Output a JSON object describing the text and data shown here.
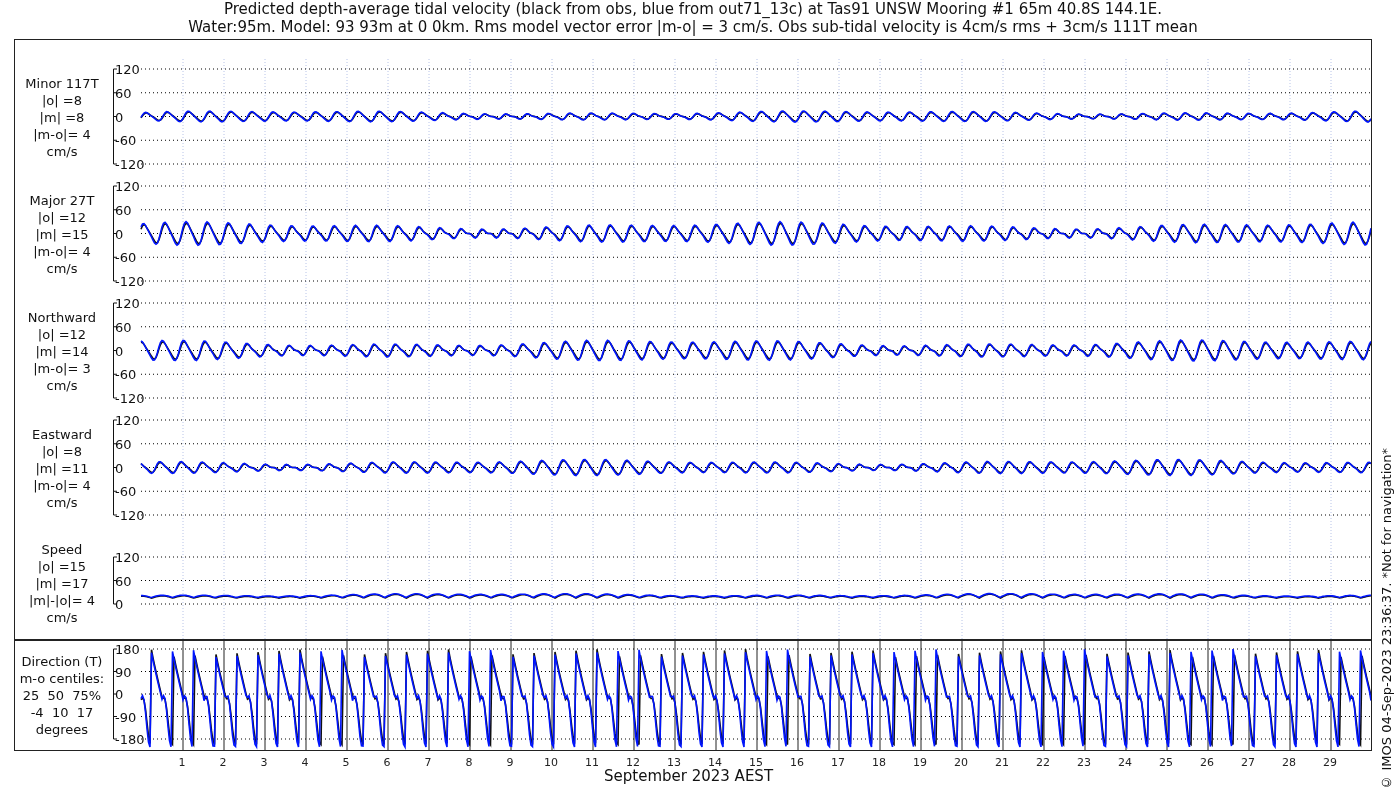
{
  "title_lines": [
    "Predicted depth-average tidal velocity (black from obs, blue from out71_13c) at Tas91 UNSW Mooring #1 65m 40.8S 144.1E.",
    "Water:95m. Model: 93 93m at 0 0km. Rms model vector error |m-o| = 3 cm/s. Obs sub-tidal velocity is 4cm/s rms + 3cm/s 111T mean"
  ],
  "panels": [
    {
      "kind": "velocity",
      "label_lines": [
        "Minor 117T",
        "|o| =8",
        "|m| =8",
        "|m-o|= 4",
        "cm/s"
      ],
      "yticks": [
        "120",
        "60",
        "0",
        "-60",
        "-120"
      ]
    },
    {
      "kind": "velocity",
      "label_lines": [
        "Major 27T",
        "|o| =12",
        "|m| =15",
        "|m-o|= 4",
        "cm/s"
      ],
      "yticks": [
        "120",
        "60",
        "0",
        "-60",
        "-120"
      ]
    },
    {
      "kind": "velocity",
      "label_lines": [
        "Northward",
        "|o| =12",
        "|m| =14",
        "|m-o|= 3",
        "cm/s"
      ],
      "yticks": [
        "120",
        "60",
        "0",
        "-60",
        "-120"
      ]
    },
    {
      "kind": "velocity",
      "label_lines": [
        "Eastward",
        "|o| =8",
        "|m| =11",
        "|m-o|= 4",
        "cm/s"
      ],
      "yticks": [
        "120",
        "60",
        "0",
        "-60",
        "-120"
      ]
    },
    {
      "kind": "speed",
      "label_lines": [
        "Speed",
        "|o| =15",
        "|m| =17",
        "|m|-|o|= 4",
        "cm/s"
      ],
      "yticks": [
        "120",
        "60",
        "0"
      ]
    },
    {
      "kind": "direction",
      "label_lines": [
        "Direction (T)",
        "m-o centiles:",
        "25  50  75%",
        "-4  10  17",
        "degrees"
      ],
      "yticks": [
        "180",
        "90",
        "0",
        "-90",
        "-180"
      ]
    }
  ],
  "xticks": [
    "1",
    "2",
    "3",
    "4",
    "5",
    "6",
    "7",
    "8",
    "9",
    "10",
    "11",
    "12",
    "13",
    "14",
    "15",
    "16",
    "17",
    "18",
    "19",
    "20",
    "21",
    "22",
    "23",
    "24",
    "25",
    "26",
    "27",
    "28",
    "29"
  ],
  "xlabel": "September 2023 AEST",
  "credit": "© IMOS 04-Sep-2023 23:36:37. *Not for navigation*"
}
